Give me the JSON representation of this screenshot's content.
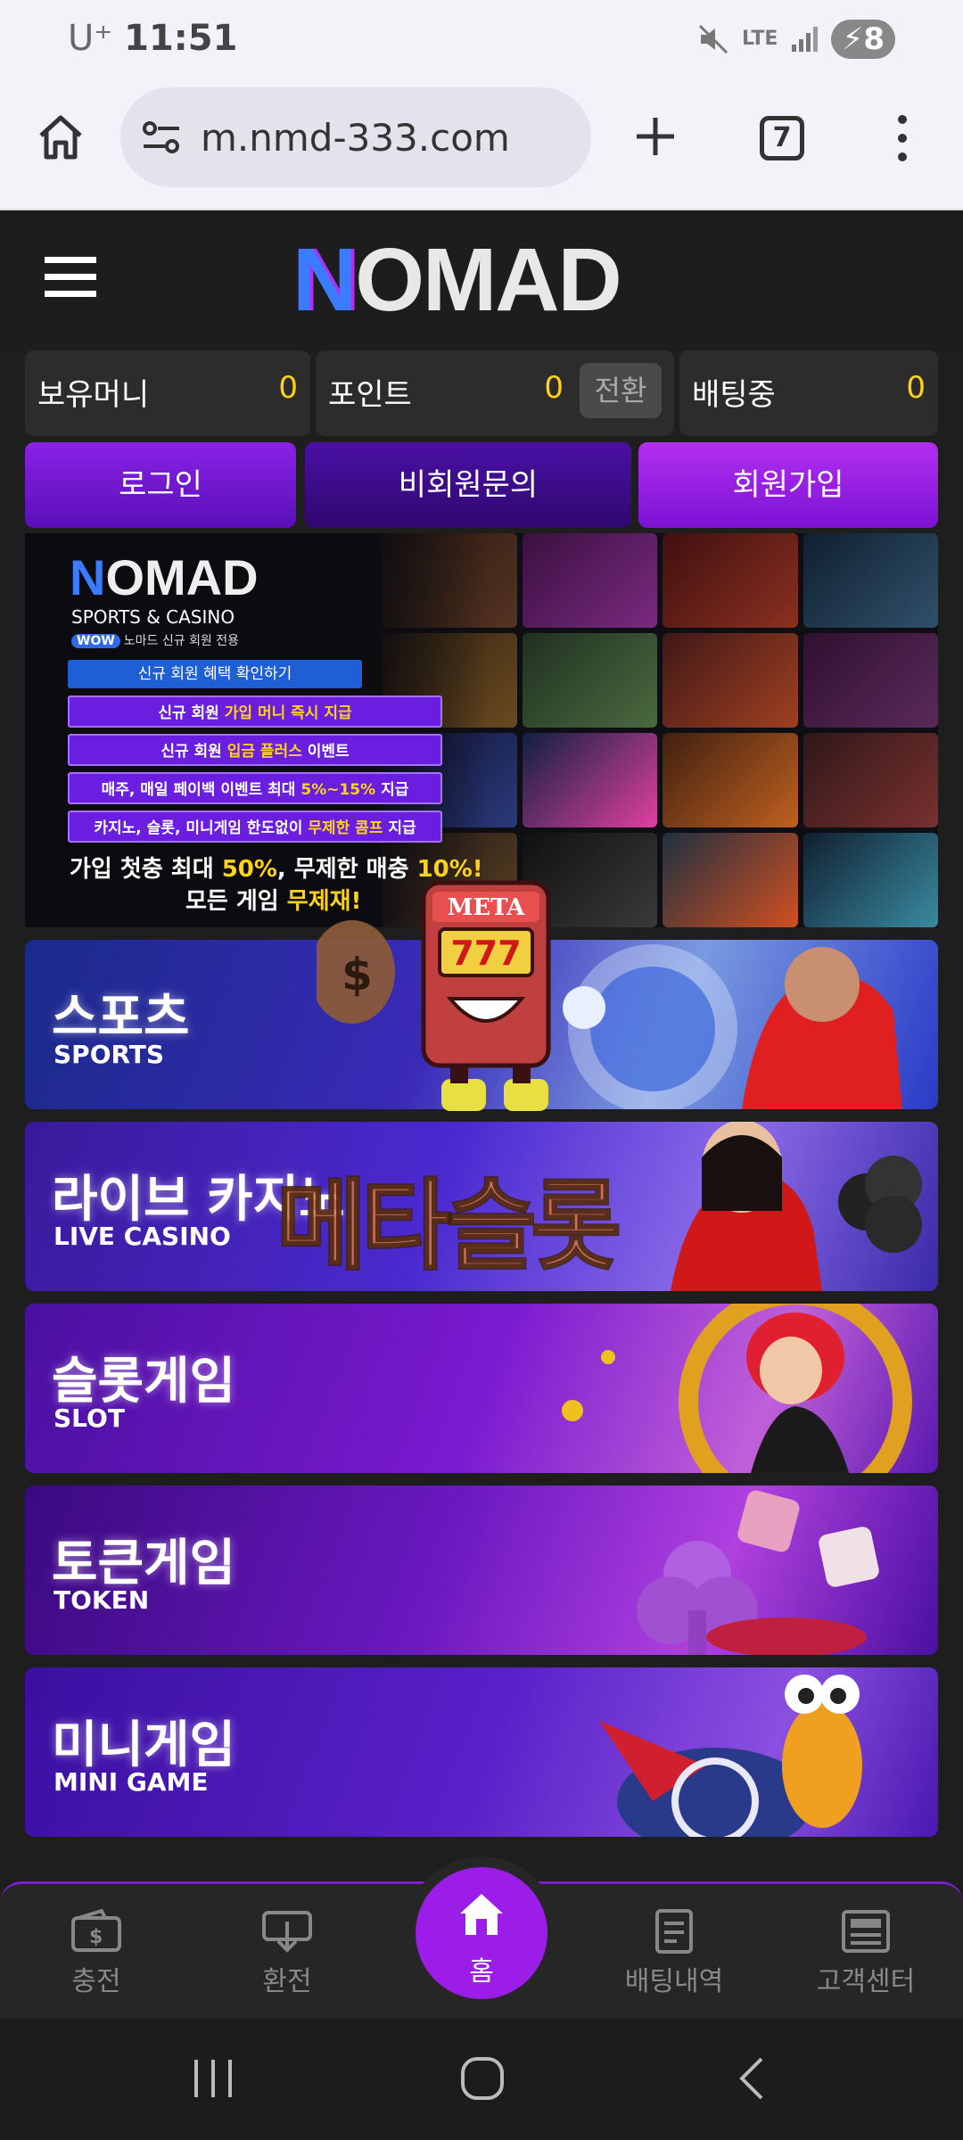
{
  "status_bar": {
    "carrier": "U⁺",
    "time": "11:51",
    "network": "LTE",
    "battery": "8"
  },
  "browser": {
    "url": "m.nmd-333.com",
    "tab_count": "7"
  },
  "site": {
    "logo_n": "N",
    "logo_rest": "OMAD"
  },
  "balances": [
    {
      "label": "보유머니",
      "value": "0"
    },
    {
      "label": "포인트",
      "value": "0",
      "action": "전환"
    },
    {
      "label": "배팅중",
      "value": "0"
    }
  ],
  "auth": {
    "login": "로그인",
    "guest_inquiry": "비회원문의",
    "signup": "회원가입"
  },
  "promo": {
    "logo_n": "N",
    "logo_rest": "OMAD",
    "subtitle": "SPORTS & CASINO",
    "wow": "WOW",
    "wow_text": "노마드 신규 회원 전용",
    "check_line": "신규 회원 혜택 확인하기",
    "line1_a": "신규 회원 ",
    "line1_hl": "가입 머니 즉시 지급",
    "line2_a": "신규 회원 ",
    "line2_hl": "입금 플러스",
    "line2_b": " 이벤트",
    "line3_a": "매주, 매일 페이백 이벤트 최대 ",
    "line3_hl": "5%~15%",
    "line3_b": " 지급",
    "line4_a": "카지노, 슬롯, 미니게임 한도없이 ",
    "line4_hl": "무제한 콤프",
    "line4_b": " 지급",
    "big1_a": "가입 첫충 최대 ",
    "big1_hl1": "50%",
    "big1_b": ", 무제한 매충 ",
    "big1_hl2": "10%!",
    "big2_a": "모든 게임 ",
    "big2_hl": "무제재!"
  },
  "categories": [
    {
      "ko": "스포츠",
      "en": "SPORTS"
    },
    {
      "ko": "라이브 카지노",
      "en": "LIVE CASINO"
    },
    {
      "ko": "슬롯게임",
      "en": "SLOT"
    },
    {
      "ko": "토큰게임",
      "en": "TOKEN"
    },
    {
      "ko": "미니게임",
      "en": "MINI GAME"
    }
  ],
  "overlay": {
    "meta_sign": "META",
    "meta_777": "777",
    "watermark": "메타슬롯"
  },
  "bottom_nav": {
    "charge": "충전",
    "exchange": "환전",
    "home": "홈",
    "bet_history": "배팅내역",
    "support": "고객센터"
  },
  "colors": {
    "accent": "#9d1de8",
    "gold": "#ffd21a",
    "bg": "#1e1e1e"
  }
}
